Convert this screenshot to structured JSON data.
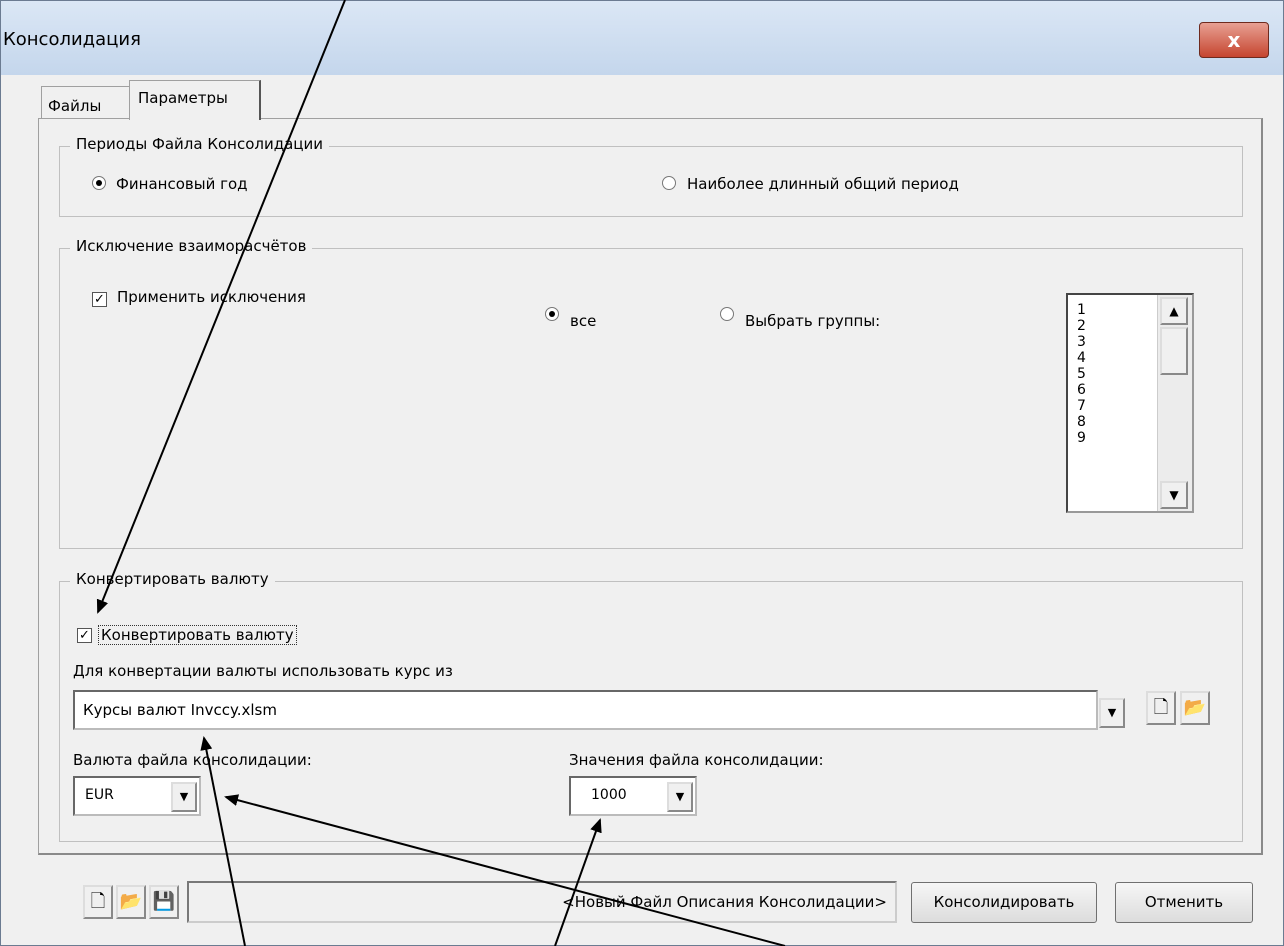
{
  "window": {
    "title": "Консолидация",
    "close_label": "x"
  },
  "tabs": [
    {
      "label": "Файлы"
    },
    {
      "label": "Параметры"
    }
  ],
  "periods": {
    "legend": "Периоды Файла Консолидации",
    "option_fiscal": "Финансовый год",
    "option_longest": "Наиболее длинный общий период",
    "selected": "fiscal"
  },
  "eliminations": {
    "legend": "Исключение взаиморасчётов",
    "apply_label": "Применить исключения",
    "apply_checked": true,
    "option_all": "все",
    "option_groups": "Выбрать группы:",
    "selected": "all",
    "groups": [
      "1",
      "2",
      "3",
      "4",
      "5",
      "6",
      "7",
      "8",
      "9"
    ]
  },
  "currency": {
    "legend": "Конвертировать валюту",
    "convert_label": "Конвертировать валюту",
    "convert_checked": true,
    "rate_source_label": "Для конвертации валюты использовать курс из",
    "rate_source_value": "Курсы валют Invccy.xlsm",
    "consolidation_currency_label": "Валюта файла консолидации:",
    "consolidation_currency_value": "EUR",
    "consolidation_values_label": "Значения файла консолидации:",
    "consolidation_values_value": "1000"
  },
  "footer": {
    "status_text": "<Новый Файл Описания Консолидации>",
    "consolidate_button": "Консолидировать",
    "cancel_button": "Отменить"
  },
  "icons": {
    "new_file": "new-file-icon",
    "open_folder": "open-folder-icon",
    "save": "save-icon"
  }
}
